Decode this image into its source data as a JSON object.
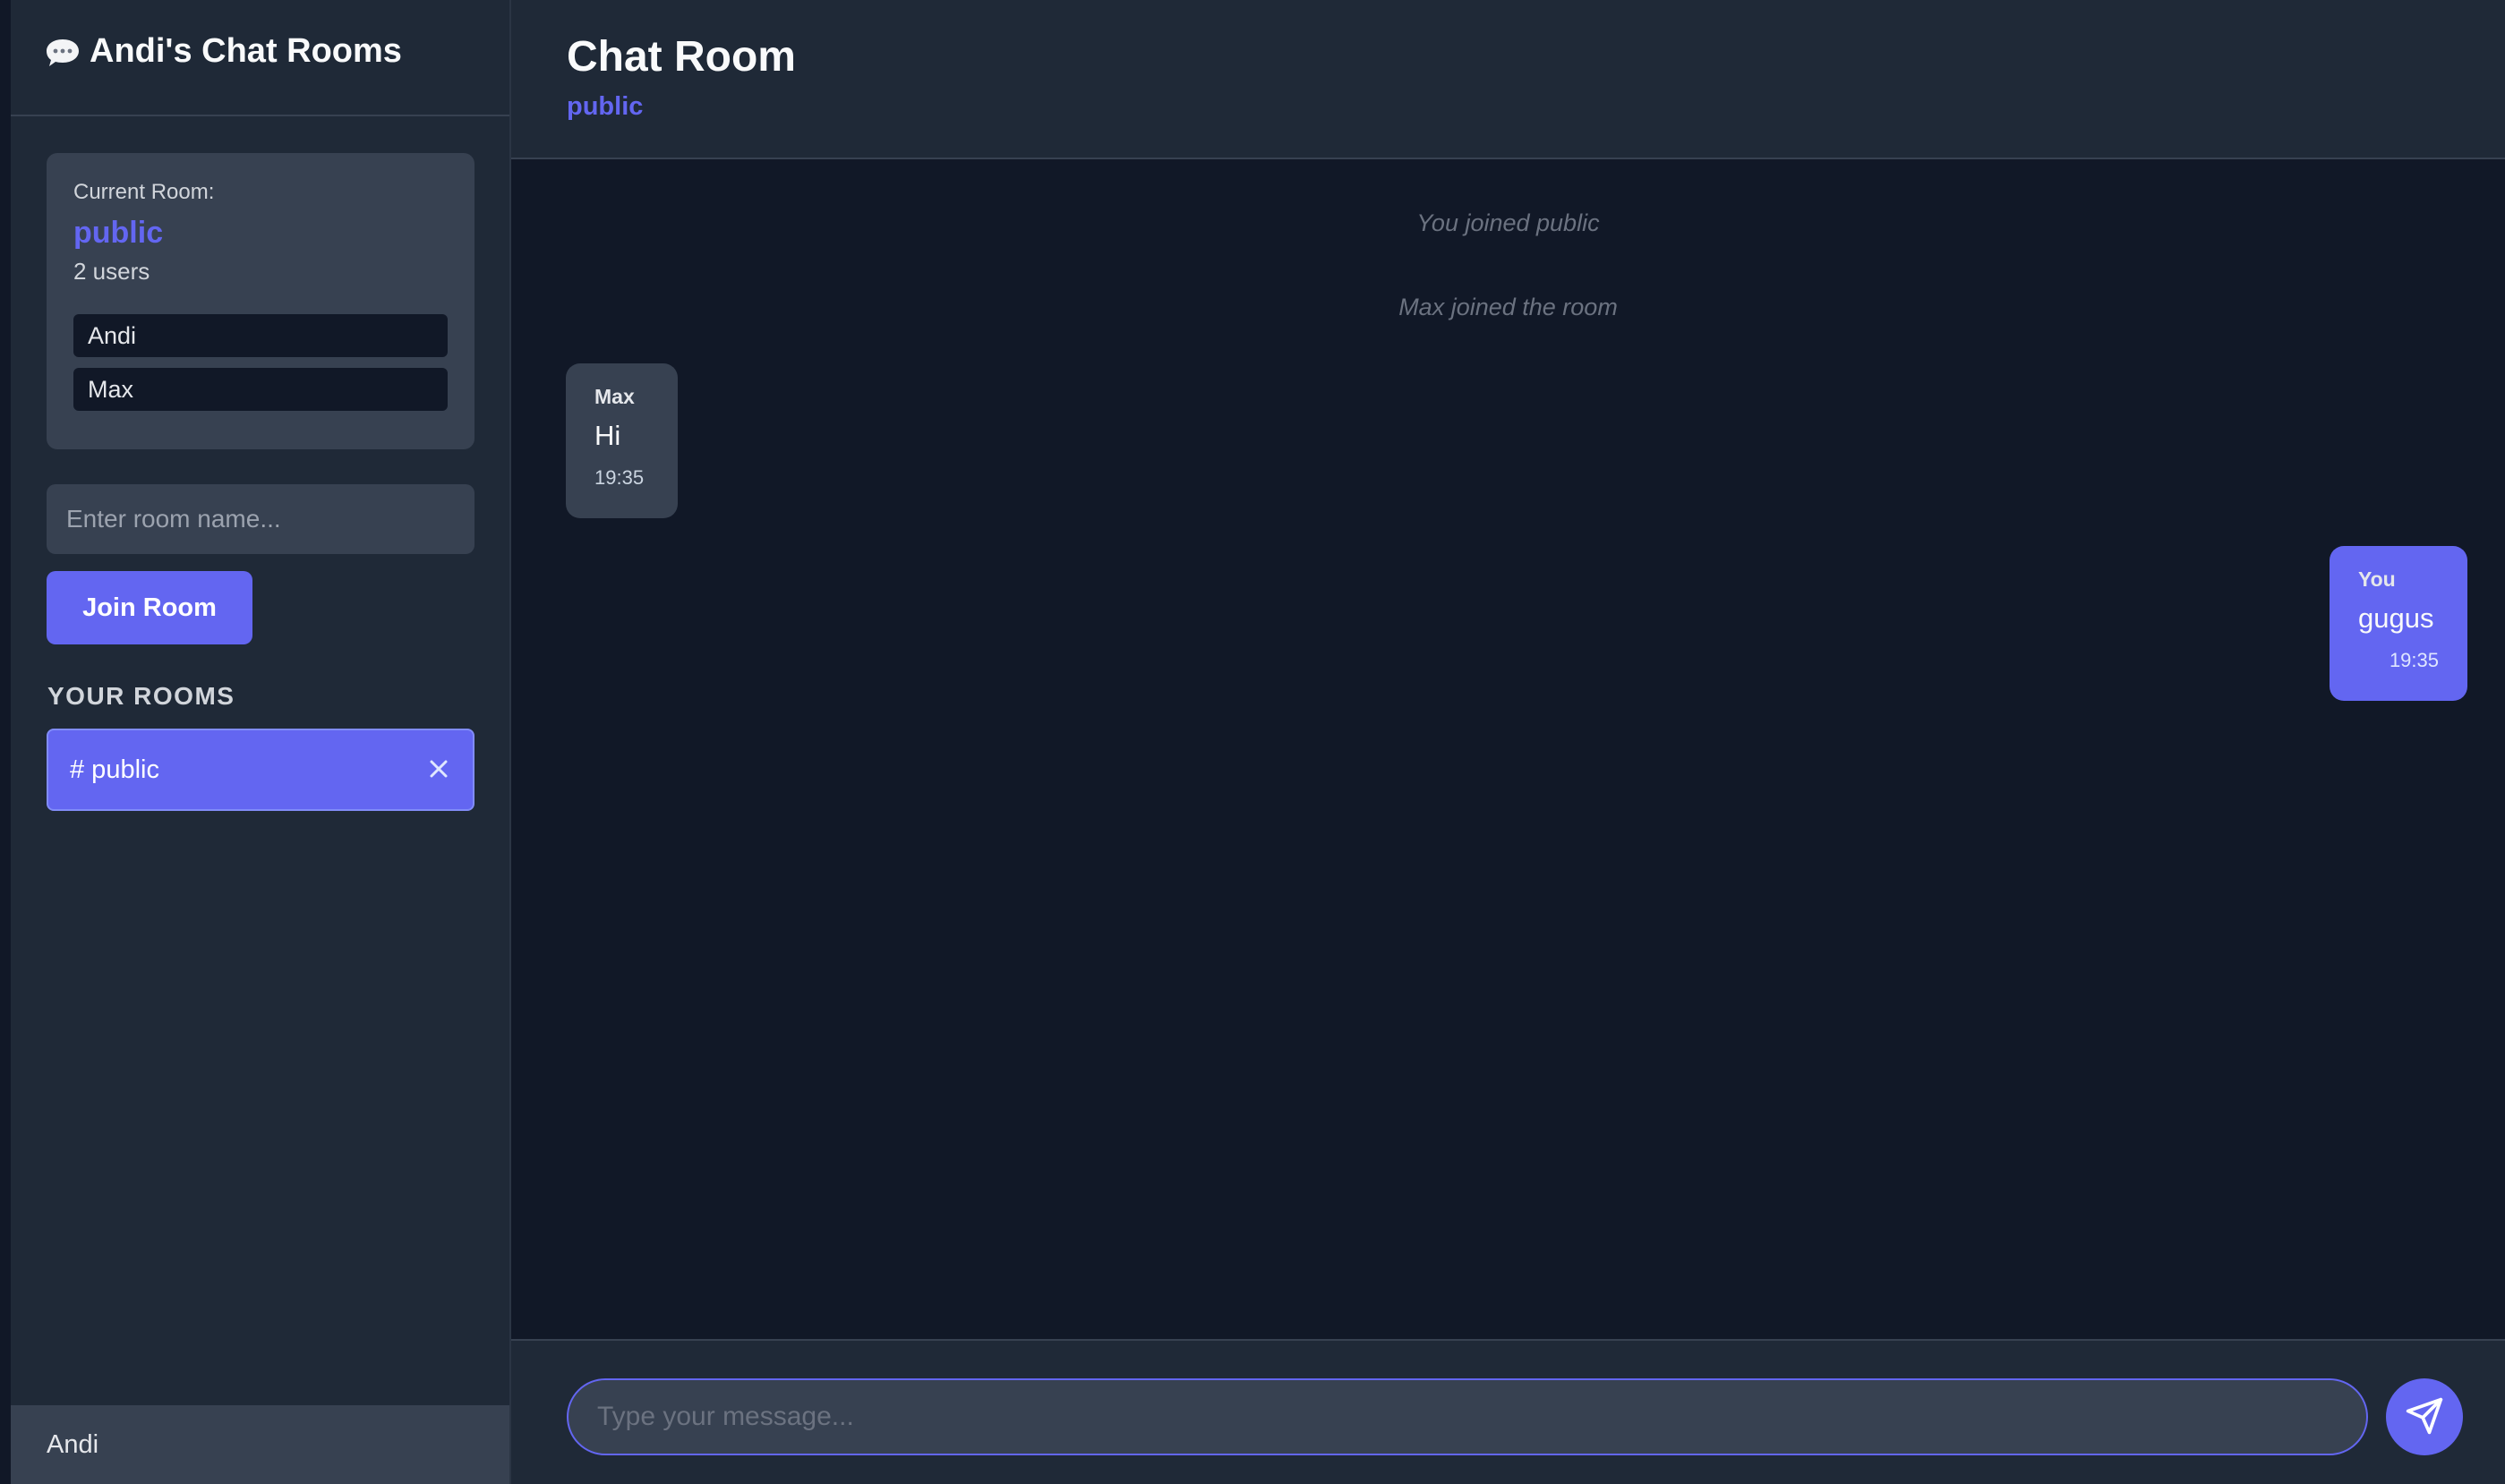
{
  "app": {
    "title": "Andi's Chat Rooms",
    "icon": "speech-bubble-icon"
  },
  "sidebar": {
    "current_room": {
      "label": "Current Room:",
      "name": "public",
      "user_count": "2 users",
      "users": [
        "Andi",
        "Max"
      ]
    },
    "room_input": {
      "placeholder": "Enter room name...",
      "value": ""
    },
    "join_button": "Join Room",
    "rooms_heading": "YOUR ROOMS",
    "rooms": [
      {
        "label": "# public",
        "close_icon": "close-icon"
      }
    ],
    "footer_user": "Andi"
  },
  "header": {
    "title": "Chat Room",
    "subtitle": "public"
  },
  "messages": {
    "system": [
      "You joined public",
      "Max joined the room"
    ],
    "bubbles": [
      {
        "sender": "Max",
        "text": "Hi",
        "time": "19:35",
        "direction": "incoming"
      },
      {
        "sender": "You",
        "text": "gugus",
        "time": "19:35",
        "direction": "outgoing"
      }
    ]
  },
  "composer": {
    "placeholder": "Type your message...",
    "value": "",
    "send_icon": "send-icon"
  },
  "colors": {
    "accent": "#6366f1",
    "sidebar_bg": "#1f2937",
    "main_bg": "#111827",
    "card_bg": "#374151"
  }
}
